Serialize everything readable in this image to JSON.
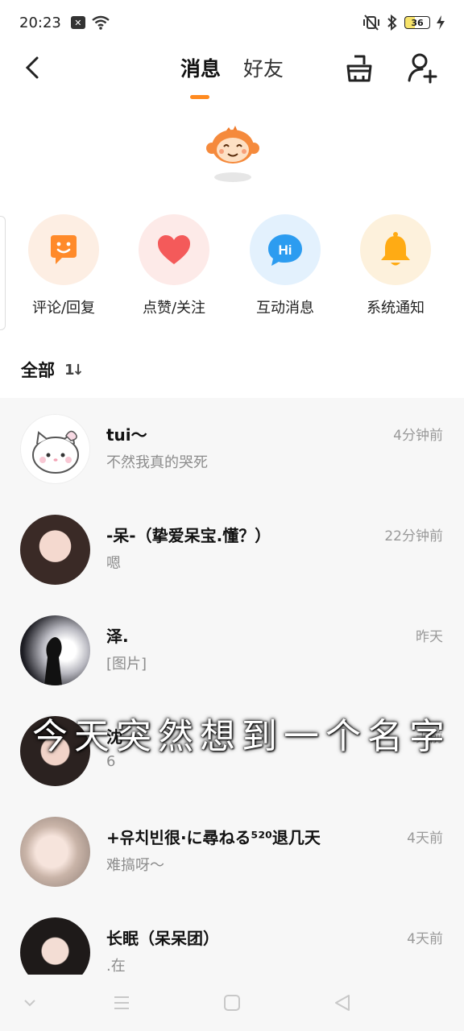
{
  "status_bar": {
    "time": "20:23",
    "battery": "36",
    "icons": [
      "notification-x-icon",
      "wifi-icon",
      "mute-vibrate-icon",
      "bluetooth-icon",
      "battery-icon",
      "charging-icon"
    ]
  },
  "header": {
    "tabs": [
      {
        "label": "消息",
        "active": true
      },
      {
        "label": "好友",
        "active": false
      }
    ],
    "accent_color": "#ff8a1f",
    "icons": [
      "back-icon",
      "clean-broom-icon",
      "add-friend-icon"
    ]
  },
  "shortcuts": [
    {
      "label": "评论/回复",
      "icon": "comment-smile-icon",
      "bg": "#fdeee3",
      "color": "#ff8a2a"
    },
    {
      "label": "点赞/关注",
      "icon": "heart-icon",
      "bg": "#fdeae8",
      "color": "#f45a5a"
    },
    {
      "label": "互动消息",
      "icon": "hi-bubble-icon",
      "bg": "#e3f1fd",
      "color": "#2c9cf0"
    },
    {
      "label": "系统通知",
      "icon": "bell-icon",
      "bg": "#fdf1dc",
      "color": "#ffab14"
    }
  ],
  "filter": {
    "label": "全部",
    "sort_icon": "1↓"
  },
  "messages": [
    {
      "name": "tui～",
      "preview": "不然我真的哭死",
      "time": "4分钟前",
      "avatar": "cartoon-cat-avatar"
    },
    {
      "name": "-呆-（挚爱呆宝.懂？）",
      "preview": "嗯",
      "time": "22分钟前",
      "avatar": "photo-avatar"
    },
    {
      "name": "泽.",
      "preview": "[图片]",
      "time": "昨天",
      "avatar": "silhouette-avatar"
    },
    {
      "name": "沈",
      "preview": "6",
      "time": "天前",
      "avatar": "photo-avatar"
    },
    {
      "name": "+유치빈很·に尋ねる⁵²⁰退几天",
      "preview": "难搞呀～",
      "time": "4天前",
      "avatar": "photo-avatar"
    },
    {
      "name": "长眠（呆呆团）",
      "preview": ".在",
      "time": "4天前",
      "avatar": "photo-avatar"
    }
  ],
  "caption": "今天突然想到一个名字",
  "navbar": {
    "icons": [
      "collapse-icon",
      "menu-icon",
      "home-icon",
      "back-triangle-icon"
    ]
  }
}
